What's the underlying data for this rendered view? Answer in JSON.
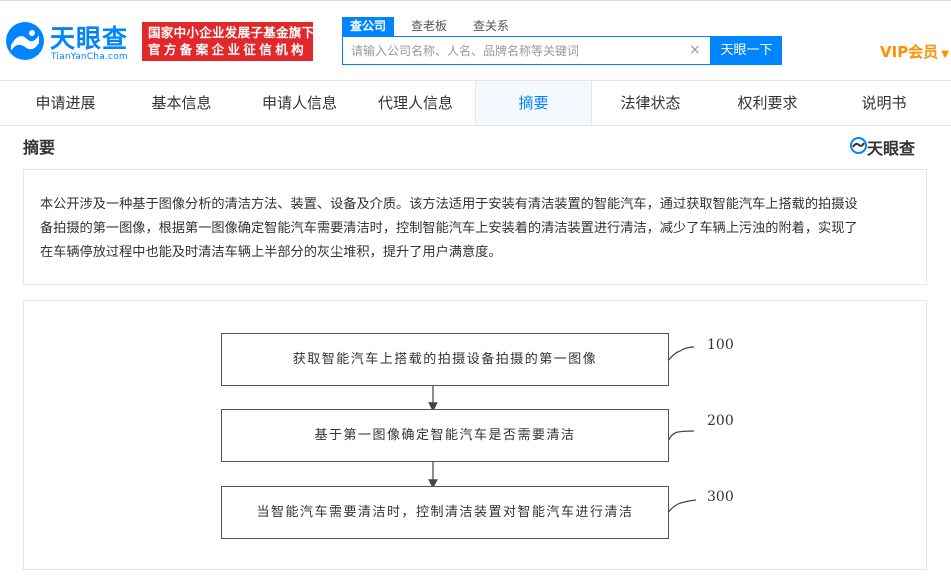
{
  "header": {
    "logo_cn": "天眼查",
    "logo_en": "TianYanCha.com",
    "badge_line1": "国家中小企业发展子基金旗下",
    "badge_line2": "官方备案企业征信机构",
    "vip_label": "VIP会员"
  },
  "search": {
    "tabs": [
      {
        "label": "查公司",
        "active": true
      },
      {
        "label": "查老板",
        "active": false
      },
      {
        "label": "查关系",
        "active": false
      }
    ],
    "placeholder": "请输入公司名称、人名、品牌名称等关键词",
    "value": "",
    "clear_symbol": "×",
    "button_label": "天眼一下"
  },
  "nav": {
    "tabs": [
      {
        "label": "申请进展",
        "active": false
      },
      {
        "label": "基本信息",
        "active": false
      },
      {
        "label": "申请人信息",
        "active": false
      },
      {
        "label": "代理人信息",
        "active": false
      },
      {
        "label": "摘要",
        "active": true
      },
      {
        "label": "法律状态",
        "active": false
      },
      {
        "label": "权利要求",
        "active": false
      },
      {
        "label": "说明书",
        "active": false
      }
    ]
  },
  "section": {
    "title": "摘要",
    "brand": "天眼查"
  },
  "abstract": {
    "lines": [
      "本公开涉及一种基于图像分析的清洁方法、装置、设备及介质。该方法适用于安装有清洁装置的智能汽车，通过获取智能汽车上搭载的拍摄设",
      "备拍摄的第一图像，根据第一图像确定智能汽车需要清洁时，控制智能汽车上安装着的清洁装置进行清洁，减少了车辆上污浊的附着，实现了",
      "在车辆停放过程中也能及时清洁车辆上半部分的灰尘堆积，提升了用户满意度。"
    ]
  },
  "figure": {
    "steps": [
      {
        "text": "获取智能汽车上搭载的拍摄设备拍摄的第一图像",
        "number": "100"
      },
      {
        "text": "基于第一图像确定智能汽车是否需要清洁",
        "number": "200"
      },
      {
        "text": "当智能汽车需要清洁时，控制清洁装置对智能汽车进行清洁",
        "number": "300"
      }
    ]
  },
  "colors": {
    "brand_blue": "#0084ff",
    "badge_red": "#e2282b",
    "vip_orange": "#ff8f00",
    "active_tab_bg": "#f4f9ff"
  }
}
